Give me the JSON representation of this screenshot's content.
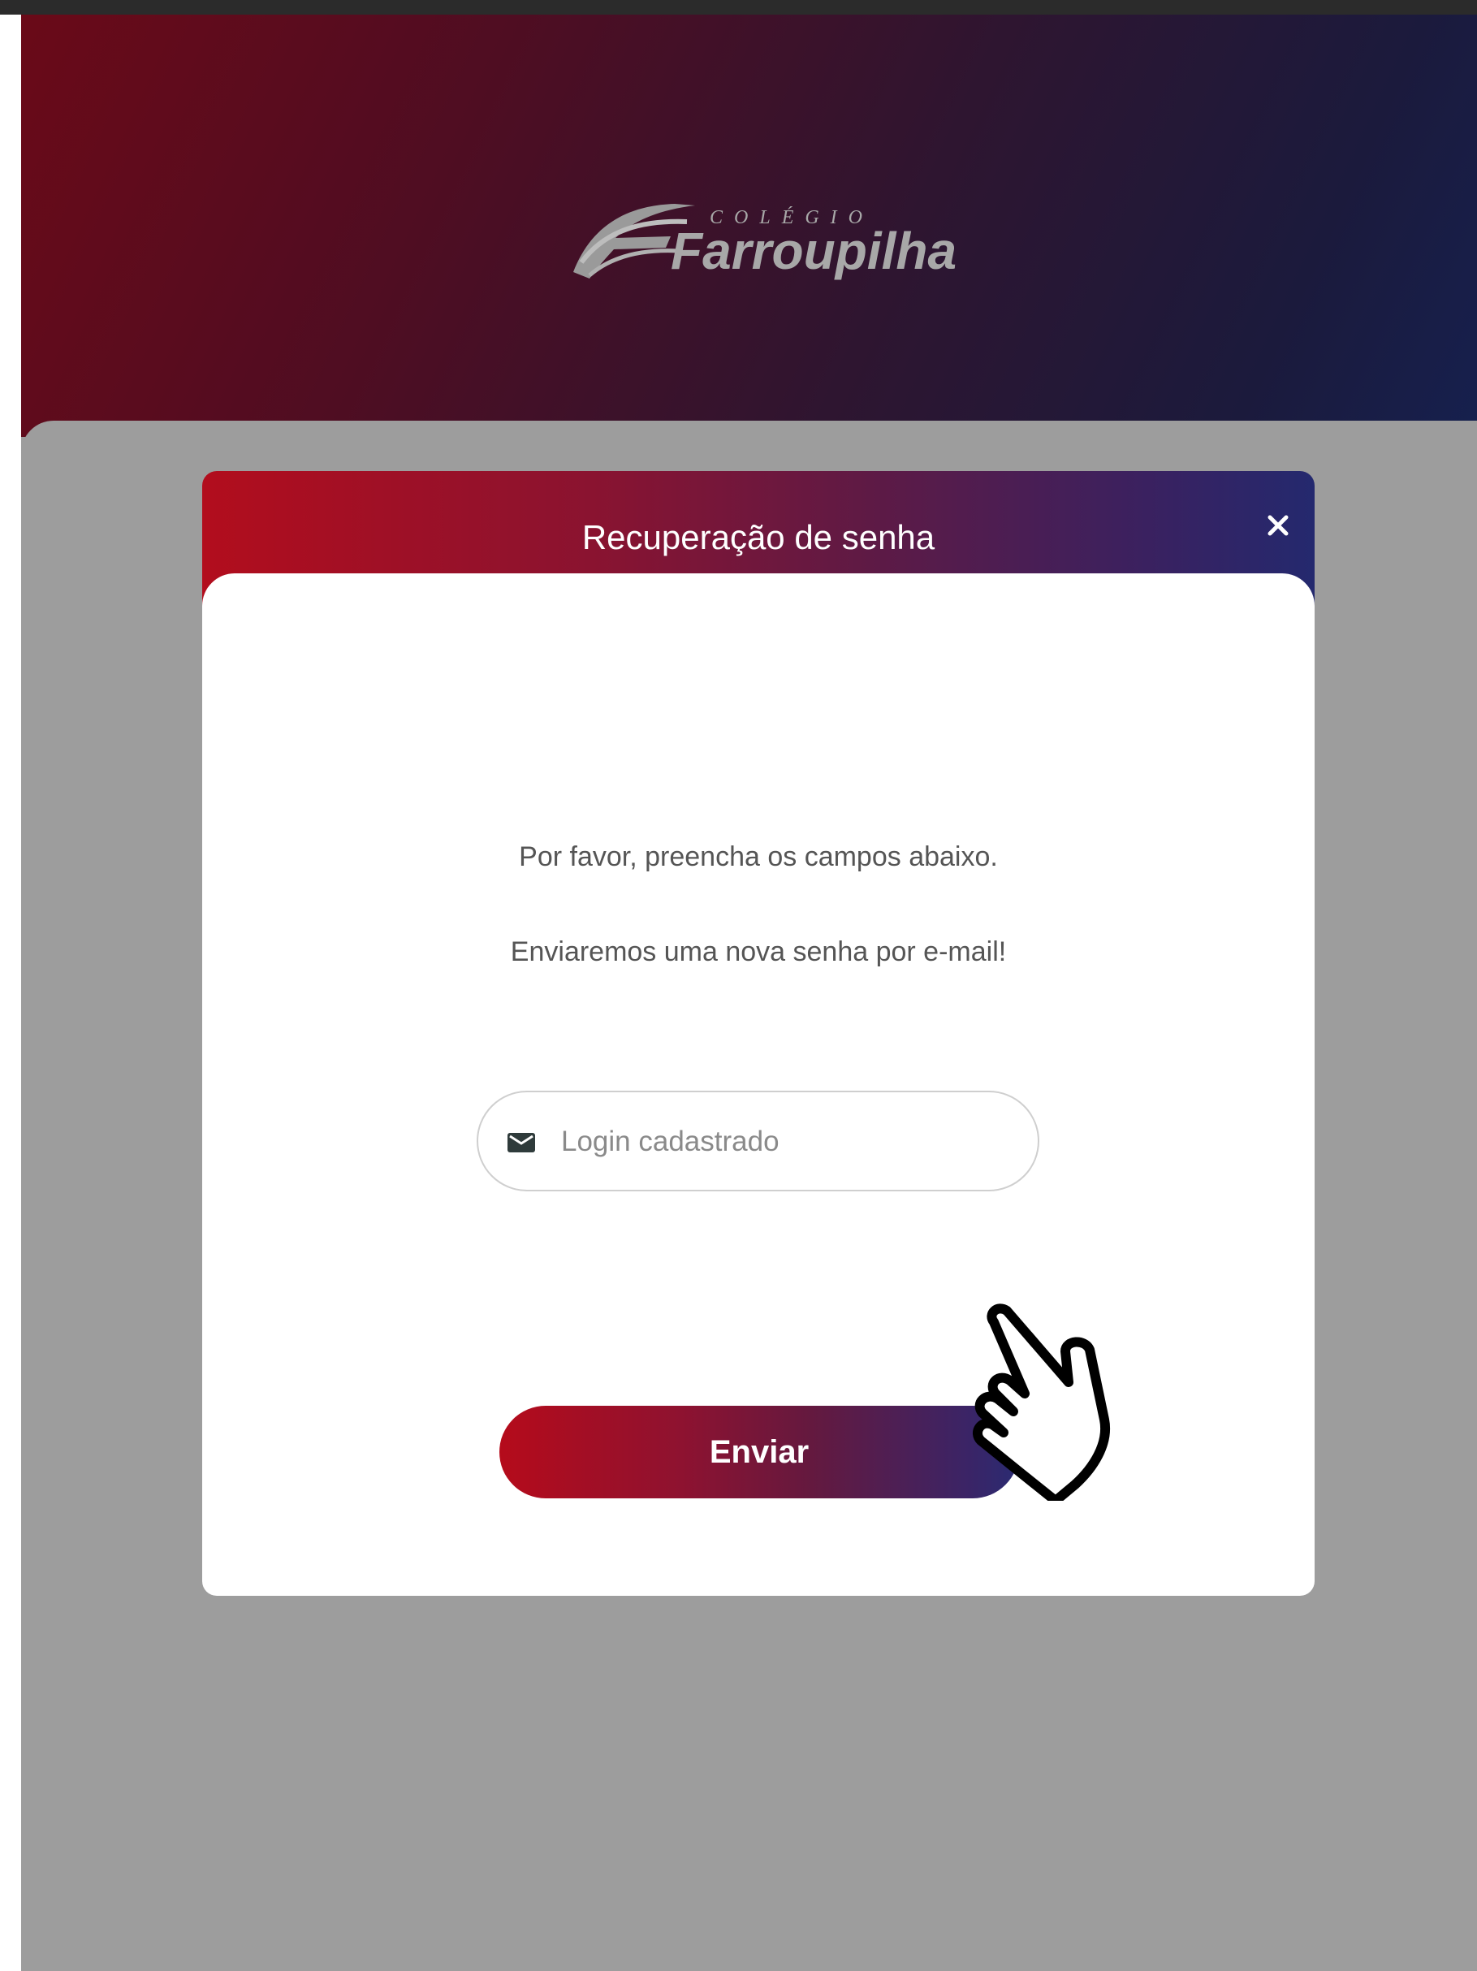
{
  "header": {
    "logo_small_text": "COLÉGIO",
    "logo_main_text": "Farroupilha"
  },
  "modal": {
    "title": "Recuperação de senha",
    "close_icon": "close-icon",
    "instruction_line1": "Por favor, preencha os campos abaixo.",
    "instruction_line2": "Enviaremos uma nova senha por e-mail!",
    "login_field": {
      "icon": "envelope-icon",
      "placeholder": "Login cadastrado",
      "value": ""
    },
    "submit_label": "Enviar"
  },
  "colors": {
    "header_gradient_start": "#6a0a18",
    "header_gradient_end": "#16204e",
    "accent_red": "#b20d1d",
    "accent_blue": "#24296e",
    "overlay_gray": "#9d9d9d"
  },
  "cursor": "hand-pointer-icon"
}
